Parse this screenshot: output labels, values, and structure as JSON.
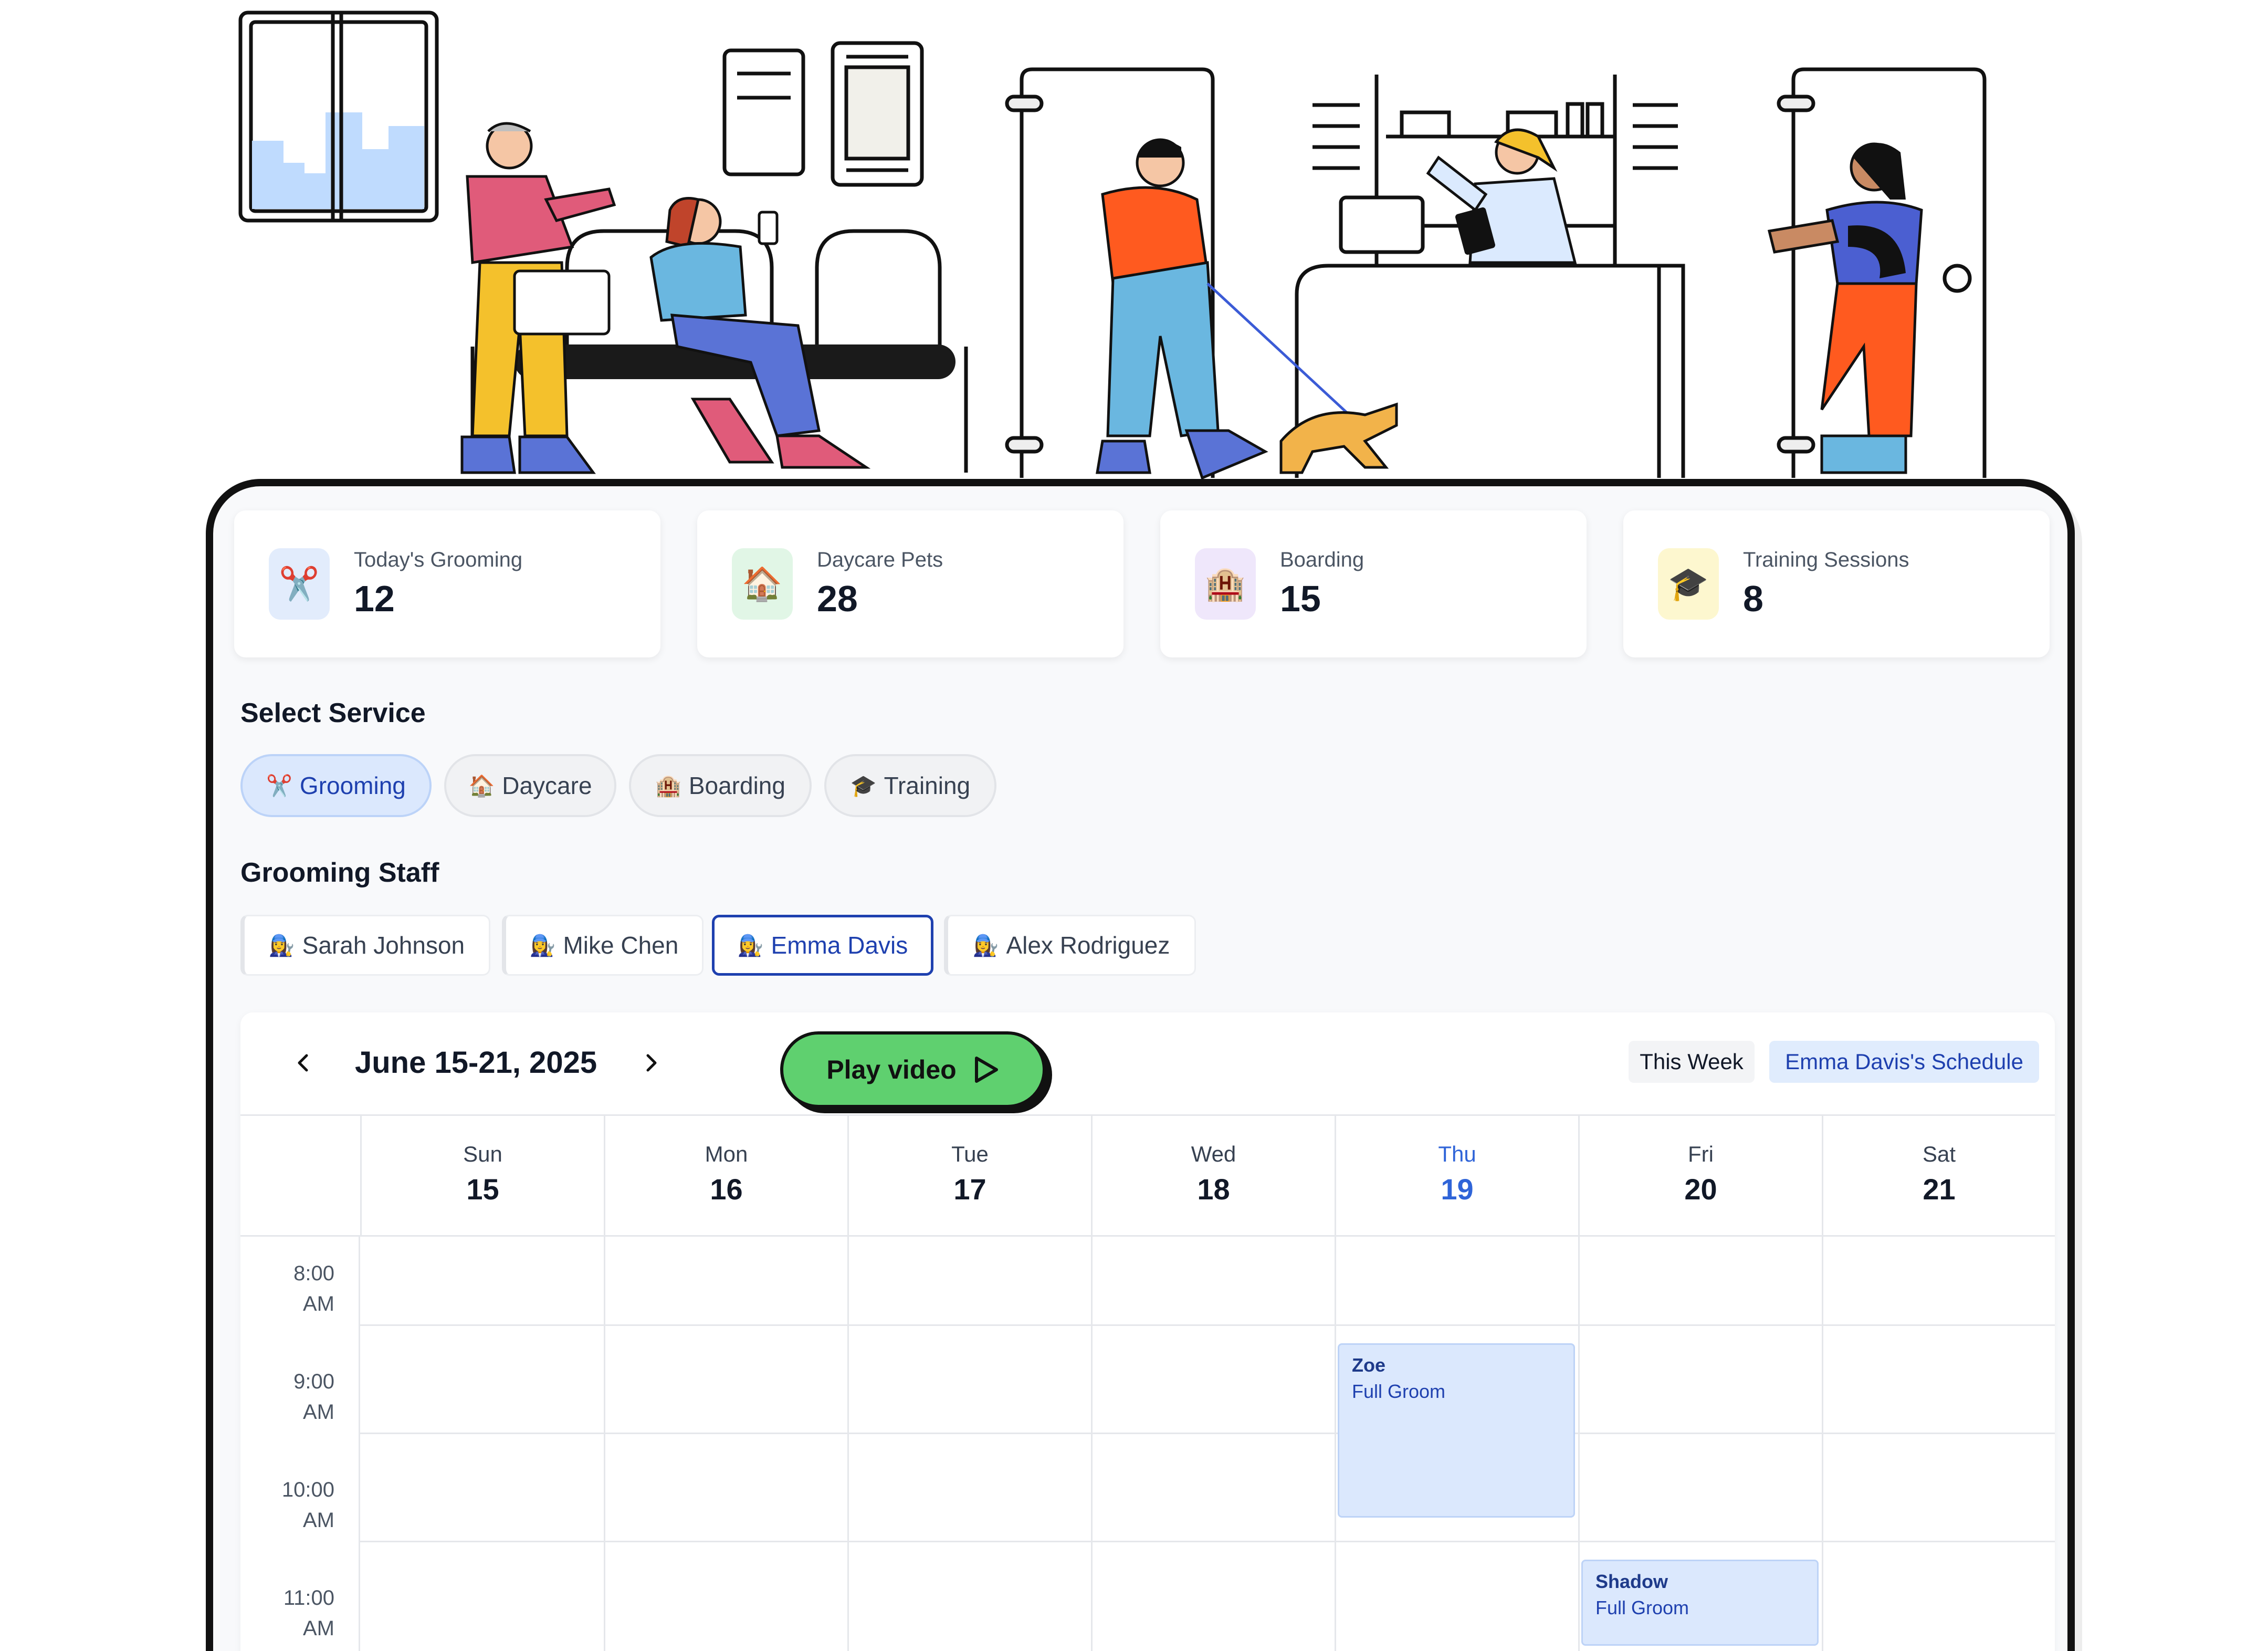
{
  "stats": [
    {
      "label": "Today's Grooming",
      "value": "12",
      "icon": "scissors-icon",
      "glyph": "✂️",
      "bg": "#e2ecfc"
    },
    {
      "label": "Daycare Pets",
      "value": "28",
      "icon": "house-icon",
      "glyph": "🏠",
      "bg": "#e1f6e6"
    },
    {
      "label": "Boarding",
      "value": "15",
      "icon": "hotel-icon",
      "glyph": "🏨",
      "bg": "#efe7fb"
    },
    {
      "label": "Training Sessions",
      "value": "8",
      "icon": "graduation-cap-icon",
      "glyph": "🎓",
      "bg": "#fdf7cf"
    }
  ],
  "services": {
    "title": "Select Service",
    "items": [
      {
        "label": "Grooming",
        "glyph": "✂️",
        "active": true
      },
      {
        "label": "Daycare",
        "glyph": "🏠",
        "active": false
      },
      {
        "label": "Boarding",
        "glyph": "🏨",
        "active": false
      },
      {
        "label": "Training",
        "glyph": "🎓",
        "active": false
      }
    ]
  },
  "staff": {
    "title": "Grooming Staff",
    "glyph": "👩‍🔧",
    "items": [
      {
        "name": "Sarah Johnson",
        "active": false
      },
      {
        "name": "Mike Chen",
        "active": false
      },
      {
        "name": "Emma Davis",
        "active": true
      },
      {
        "name": "Alex Rodriguez",
        "active": false
      }
    ]
  },
  "calendar": {
    "range": "June 15-21, 2025",
    "play_label": "Play video",
    "this_week": "This Week",
    "schedule_label": "Emma Davis's Schedule",
    "days": [
      {
        "name": "Sun",
        "date": "15",
        "today": false
      },
      {
        "name": "Mon",
        "date": "16",
        "today": false
      },
      {
        "name": "Tue",
        "date": "17",
        "today": false
      },
      {
        "name": "Wed",
        "date": "18",
        "today": false
      },
      {
        "name": "Thu",
        "date": "19",
        "today": true
      },
      {
        "name": "Fri",
        "date": "20",
        "today": false
      },
      {
        "name": "Sat",
        "date": "21",
        "today": false
      }
    ],
    "times": [
      {
        "hour": "8:00",
        "period": "AM"
      },
      {
        "hour": "9:00",
        "period": "AM"
      },
      {
        "hour": "10:00",
        "period": "AM"
      },
      {
        "hour": "11:00",
        "period": "AM"
      }
    ],
    "events": [
      {
        "pet": "Zoe",
        "service": "Full Groom",
        "day": "Thu",
        "start": "9:00 AM",
        "end": "10:30 AM"
      },
      {
        "pet": "Shadow",
        "service": "Full Groom",
        "day": "Fri",
        "start": "11:00 AM"
      }
    ]
  },
  "colors": {
    "accent": "#1e40af",
    "today": "#2f64d8",
    "play_button": "#5fd06f",
    "event_bg": "#dbe8fd"
  }
}
